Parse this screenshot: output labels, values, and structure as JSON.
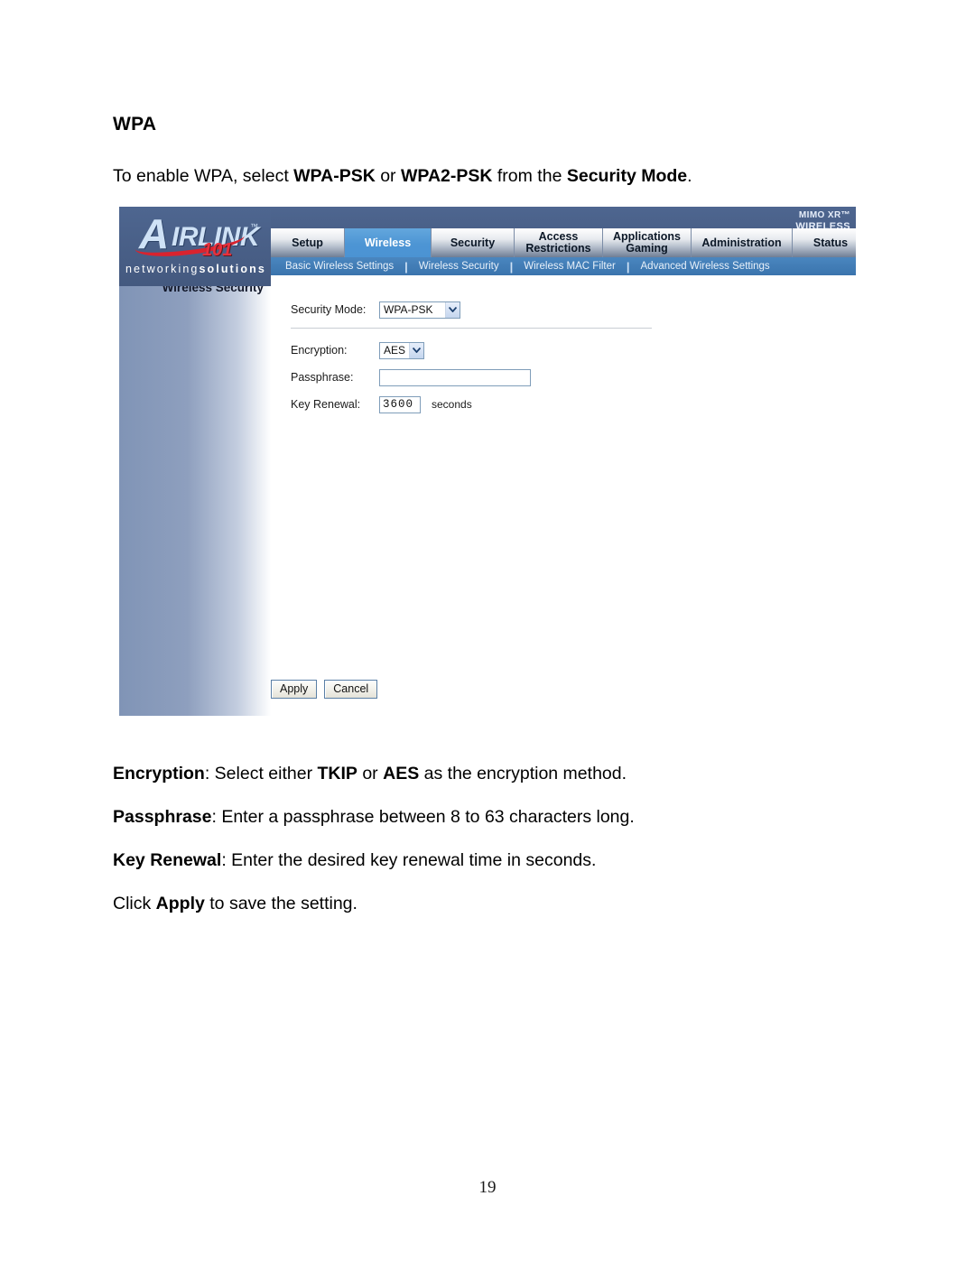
{
  "document": {
    "heading": "WPA",
    "intro": {
      "part1": "To enable WPA, select ",
      "bold1": "WPA-PSK",
      "part2": " or ",
      "bold2": "WPA2-PSK",
      "part3": " from the ",
      "bold3": "Security Mode",
      "part4": "."
    },
    "encryption_note": {
      "term": "Encryption",
      "part1": ": Select either ",
      "bold1": "TKIP",
      "part2": " or ",
      "bold2": "AES",
      "part3": " as the encryption method."
    },
    "passphrase_note": {
      "term": "Passphrase",
      "rest": ": Enter a passphrase between 8 to 63 characters long."
    },
    "key_renewal_note": {
      "term": "Key Renewal",
      "rest": ": Enter the desired key renewal time in seconds."
    },
    "apply_note": {
      "part1": "Click ",
      "bold1": "Apply",
      "part2": " to save the setting."
    },
    "page_number": "19"
  },
  "router_ui": {
    "brand": {
      "initial": "A",
      "rest": "IRLINK",
      "tm": "™",
      "model": "101",
      "tagline_light": "networking",
      "tagline_bold": "solutions"
    },
    "corner": {
      "line1": "MIMO XR™",
      "line2": "WIRELESS ROUTER"
    },
    "tabs": [
      {
        "label": "Setup",
        "line2": "",
        "active": false
      },
      {
        "label": "Wireless",
        "line2": "",
        "active": true
      },
      {
        "label": "Security",
        "line2": "",
        "active": false
      },
      {
        "label": "Access",
        "line2": "Restrictions",
        "active": false
      },
      {
        "label": "Applications",
        "line2": "Gaming",
        "active": false
      },
      {
        "label": "Administration",
        "line2": "",
        "active": false
      },
      {
        "label": "Status",
        "line2": "",
        "active": false
      }
    ],
    "subnav": [
      "Basic Wireless Settings",
      "Wireless Security",
      "Wireless MAC Filter",
      "Advanced Wireless Settings"
    ],
    "subnav_separator": "|",
    "sidebar_title": "Wireless Security",
    "form": {
      "security_mode_label": "Security Mode:",
      "security_mode_value": "WPA-PSK",
      "encryption_label": "Encryption:",
      "encryption_value": "AES",
      "passphrase_label": "Passphrase:",
      "passphrase_value": "",
      "passphrase_placeholder": "",
      "key_renewal_label": "Key Renewal:",
      "key_renewal_value": "3600",
      "key_renewal_unit": "seconds"
    },
    "buttons": {
      "apply": "Apply",
      "cancel": "Cancel"
    },
    "colors": {
      "header_blue": "#4a628c",
      "active_tab": "#4d95d4",
      "subnav_blue": "#3e7bb6",
      "sidebar_gradient_start": "#8094b6",
      "accent_red": "#d9232e"
    }
  }
}
